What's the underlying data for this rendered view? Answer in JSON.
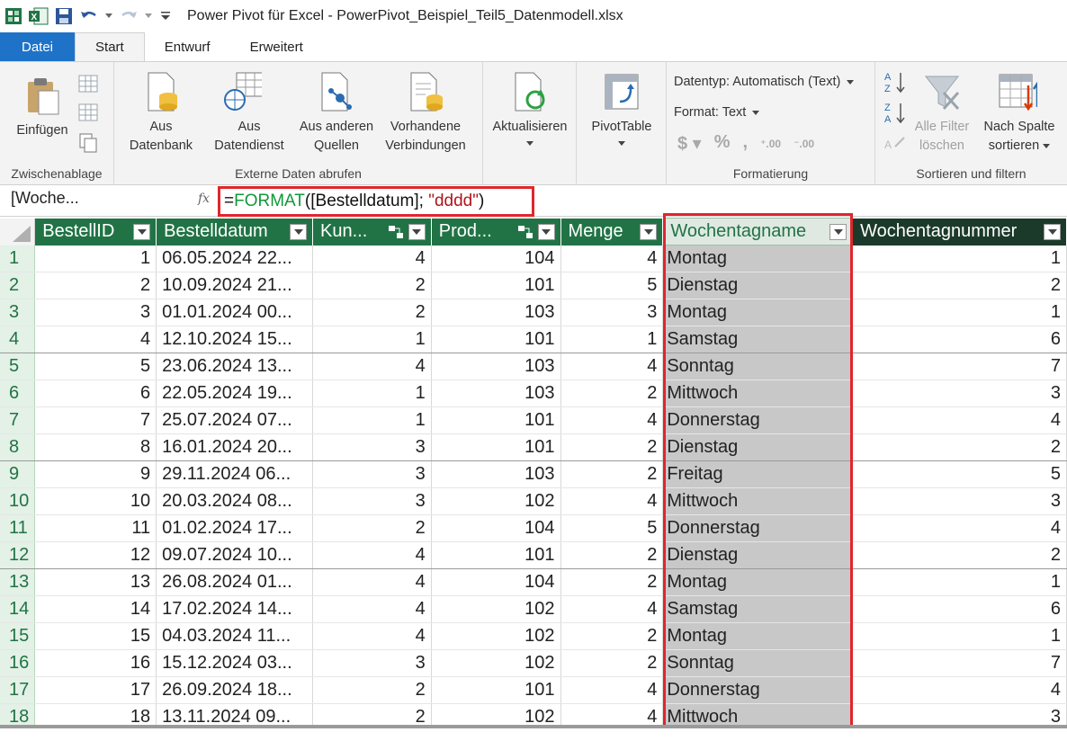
{
  "window": {
    "title": "Power Pivot für Excel - PowerPivot_Beispiel_Teil5_Datenmodell.xlsx"
  },
  "tabs": [
    {
      "label": "Datei"
    },
    {
      "label": "Start"
    },
    {
      "label": "Entwurf"
    },
    {
      "label": "Erweitert"
    }
  ],
  "ribbon": {
    "clipboard": {
      "paste_label": "Einfügen",
      "group_label": "Zwischenablage"
    },
    "external": {
      "db_line1": "Aus",
      "db_line2": "Datenbank",
      "ds_line1": "Aus",
      "ds_line2": "Datendienst",
      "other_line1": "Aus anderen",
      "other_line2": "Quellen",
      "exist_line1": "Vorhandene",
      "exist_line2": "Verbindungen",
      "group_label": "Externe Daten abrufen"
    },
    "refresh": {
      "label": "Aktualisieren"
    },
    "pivot": {
      "label": "PivotTable"
    },
    "format": {
      "datatype": "Datentyp: Automatisch (Text)",
      "format": "Format: Text",
      "group_label": "Formatierung"
    },
    "sort": {
      "clear_line1": "Alle Filter",
      "clear_line2": "löschen",
      "bycol_line1": "Nach Spalte",
      "bycol_line2": "sortieren",
      "group_label": "Sortieren und filtern"
    }
  },
  "formula_bar": {
    "name_box": "[Woche...",
    "fx": "fx",
    "eq": "=",
    "fn": "FORMAT",
    "open": "(",
    "ref": "[Bestelldatum]",
    "sep": "; ",
    "str": "\"dddd\"",
    "close": ")"
  },
  "columns": [
    "BestellID",
    "Bestelldatum",
    "Kun...",
    "Prod...",
    "Menge",
    "Wochentagname",
    "Wochentagnummer"
  ],
  "rows": [
    [
      "1",
      "1",
      "06.05.2024 22...",
      "4",
      "104",
      "4",
      "Montag",
      "1"
    ],
    [
      "2",
      "2",
      "10.09.2024 21...",
      "2",
      "101",
      "5",
      "Dienstag",
      "2"
    ],
    [
      "3",
      "3",
      "01.01.2024 00...",
      "2",
      "103",
      "3",
      "Montag",
      "1"
    ],
    [
      "4",
      "4",
      "12.10.2024 15...",
      "1",
      "101",
      "1",
      "Samstag",
      "6"
    ],
    [
      "5",
      "5",
      "23.06.2024 13...",
      "4",
      "103",
      "4",
      "Sonntag",
      "7"
    ],
    [
      "6",
      "6",
      "22.05.2024 19...",
      "1",
      "103",
      "2",
      "Mittwoch",
      "3"
    ],
    [
      "7",
      "7",
      "25.07.2024 07...",
      "1",
      "101",
      "4",
      "Donnerstag",
      "4"
    ],
    [
      "8",
      "8",
      "16.01.2024 20...",
      "3",
      "101",
      "2",
      "Dienstag",
      "2"
    ],
    [
      "9",
      "9",
      "29.11.2024 06...",
      "3",
      "103",
      "2",
      "Freitag",
      "5"
    ],
    [
      "10",
      "10",
      "20.03.2024 08...",
      "3",
      "102",
      "4",
      "Mittwoch",
      "3"
    ],
    [
      "11",
      "11",
      "01.02.2024 17...",
      "2",
      "104",
      "5",
      "Donnerstag",
      "4"
    ],
    [
      "12",
      "12",
      "09.07.2024 10...",
      "4",
      "101",
      "2",
      "Dienstag",
      "2"
    ],
    [
      "13",
      "13",
      "26.08.2024 01...",
      "4",
      "104",
      "2",
      "Montag",
      "1"
    ],
    [
      "14",
      "14",
      "17.02.2024 14...",
      "4",
      "102",
      "4",
      "Samstag",
      "6"
    ],
    [
      "15",
      "15",
      "04.03.2024 11...",
      "4",
      "102",
      "2",
      "Montag",
      "1"
    ],
    [
      "16",
      "16",
      "15.12.2024 03...",
      "3",
      "102",
      "2",
      "Sonntag",
      "7"
    ],
    [
      "17",
      "17",
      "26.09.2024 18...",
      "2",
      "101",
      "4",
      "Donnerstag",
      "4"
    ],
    [
      "18",
      "18",
      "13.11.2024 09...",
      "2",
      "102",
      "4",
      "Mittwoch",
      "3"
    ]
  ]
}
